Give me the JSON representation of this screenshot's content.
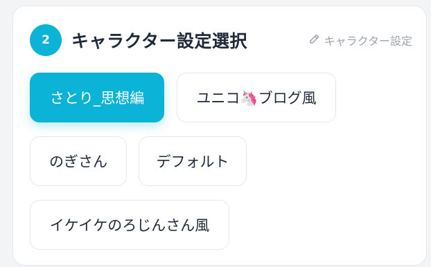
{
  "step": {
    "number": "2"
  },
  "header": {
    "title": "キャラクター設定選択",
    "edit_label": "キャラクター設定"
  },
  "options": [
    {
      "label": "さとり_思想編",
      "selected": true
    },
    {
      "label": "ユニコ🦄ブログ風",
      "selected": false
    },
    {
      "label": "のぎさん",
      "selected": false
    },
    {
      "label": "デフォルト",
      "selected": false
    },
    {
      "label": "イケイケのろじんさん風",
      "selected": false
    }
  ],
  "colors": {
    "accent": "#0bb3d6",
    "text": "#1f2937",
    "muted": "#9ca3af",
    "border": "#e5e7eb"
  }
}
